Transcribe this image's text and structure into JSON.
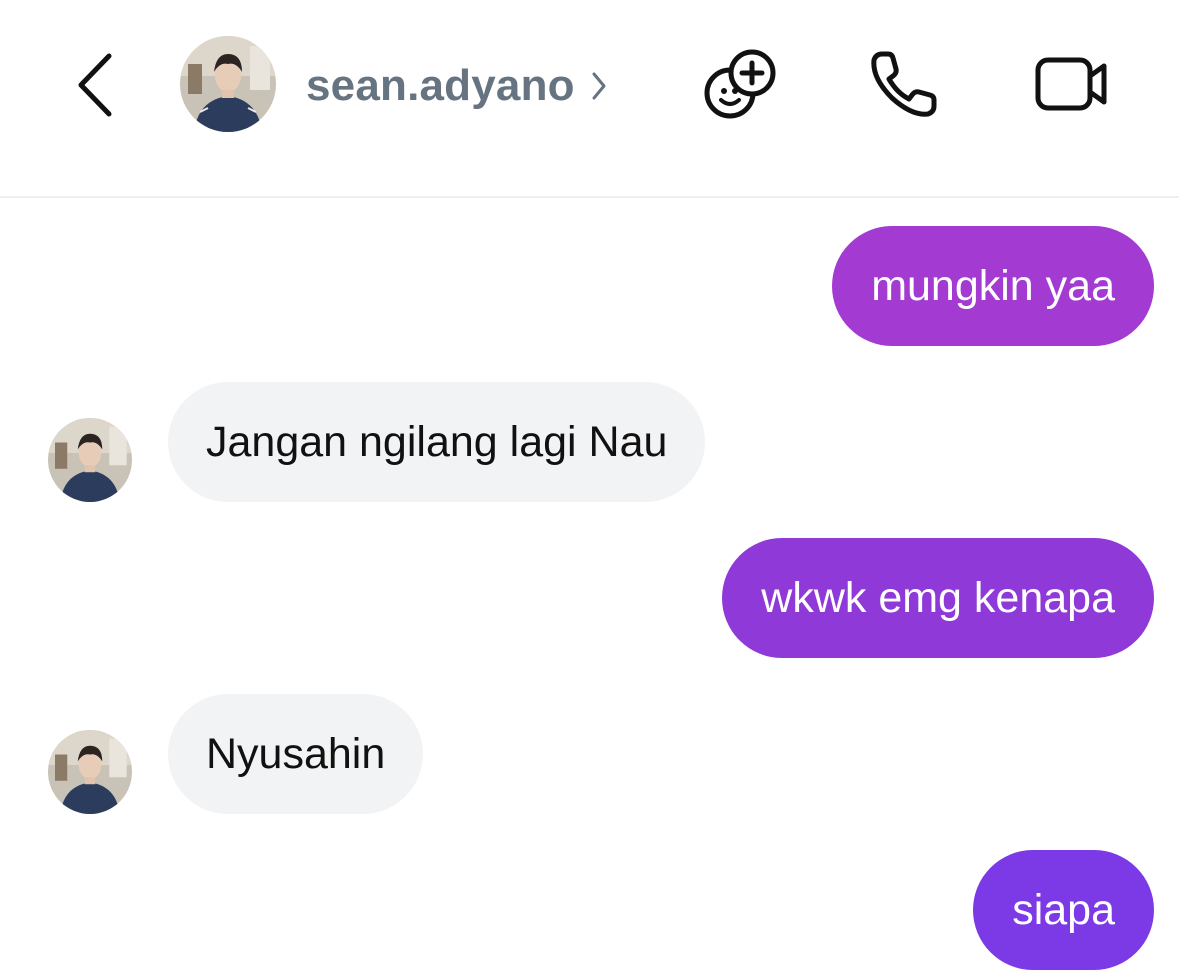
{
  "header": {
    "contact_name": "sean.adyano",
    "icons": {
      "back": "chevron-left-icon",
      "chevron": "chevron-right-icon",
      "effects": "sticker-add-icon",
      "call": "phone-icon",
      "video": "video-camera-icon"
    }
  },
  "messages": [
    {
      "direction": "outgoing",
      "text": "mungkin yaa",
      "color": "#a33bd3"
    },
    {
      "direction": "incoming",
      "text": "Jangan ngilang lagi Nau",
      "color": "#f2f3f5"
    },
    {
      "direction": "outgoing",
      "text": "wkwk emg kenapa",
      "color": "#8f3ad8"
    },
    {
      "direction": "incoming",
      "text": "Nyusahin",
      "color": "#f2f3f5"
    },
    {
      "direction": "outgoing",
      "text": "siapa",
      "color": "#7c3ae6"
    }
  ],
  "colors": {
    "header_title": "#667380",
    "incoming_bubble": "#f2f3f5",
    "divider": "#efefef"
  }
}
